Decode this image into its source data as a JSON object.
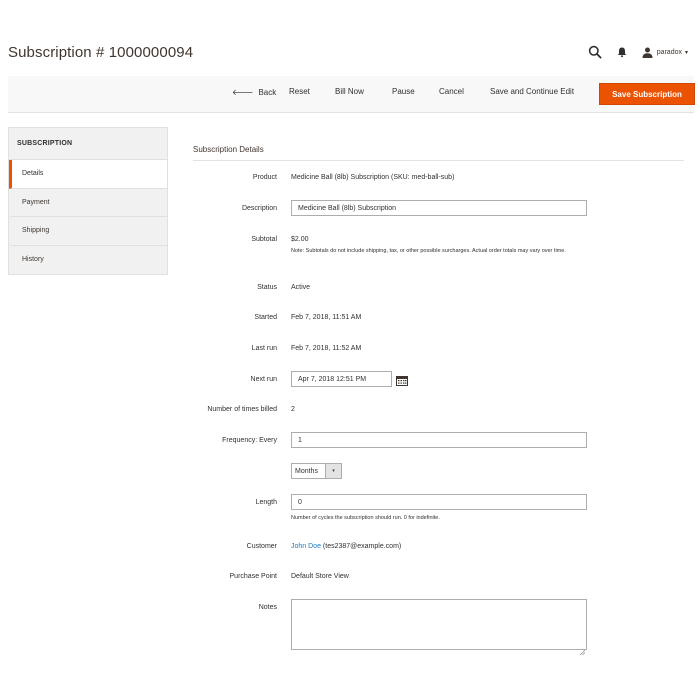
{
  "page": {
    "title": "Subscription # 1000000094"
  },
  "header": {
    "user_name": "paradox",
    "user_caret": "▾"
  },
  "actions": {
    "back_arrow": "🡐",
    "back": "Back",
    "reset": "Reset",
    "bill_now": "Bill Now",
    "pause": "Pause",
    "cancel": "Cancel",
    "save_continue": "Save and Continue Edit",
    "save": "Save Subscription"
  },
  "sidebar": {
    "title": "SUBSCRIPTION",
    "items": [
      {
        "label": "Details",
        "active": true
      },
      {
        "label": "Payment",
        "active": false
      },
      {
        "label": "Shipping",
        "active": false
      },
      {
        "label": "History",
        "active": false
      }
    ]
  },
  "details": {
    "section_title": "Subscription Details",
    "product_label": "Product",
    "product_value": "Medicine Ball (8lb) Subscription (SKU: med-ball-sub)",
    "description_label": "Description",
    "description_value": "Medicine Ball (8lb) Subscription",
    "subtotal_label": "Subtotal",
    "subtotal_value": "$2.00",
    "subtotal_note": "Note: Subtotals do not include shipping, tax, or other possible surcharges. Actual order totals may vary over time.",
    "status_label": "Status",
    "status_value": "Active",
    "started_label": "Started",
    "started_value": "Feb 7, 2018, 11:51 AM",
    "last_run_label": "Last run",
    "last_run_value": "Feb 7, 2018, 11:52 AM",
    "next_run_label": "Next run",
    "next_run_value": "Apr 7, 2018 12:51 PM",
    "times_billed_label": "Number of times billed",
    "times_billed_value": "2",
    "frequency_label": "Frequency: Every",
    "frequency_value": "1",
    "frequency_unit": "Months",
    "frequency_unit_caret": "▾",
    "length_label": "Length",
    "length_value": "0",
    "length_note": "Number of cycles the subscription should run. 0 for indefinite.",
    "customer_label": "Customer",
    "customer_name": "John Doe",
    "customer_email": "(tes2387@example.com)",
    "purchase_point_label": "Purchase Point",
    "purchase_point_value": "Default Store View",
    "notes_label": "Notes",
    "notes_value": ""
  },
  "colors": {
    "accent": "#eb5202",
    "link": "#1979c3",
    "text": "#303030"
  },
  "icons": {
    "search": "search-icon",
    "bell": "bell-icon",
    "user": "user-icon",
    "calendar": "calendar-icon"
  }
}
